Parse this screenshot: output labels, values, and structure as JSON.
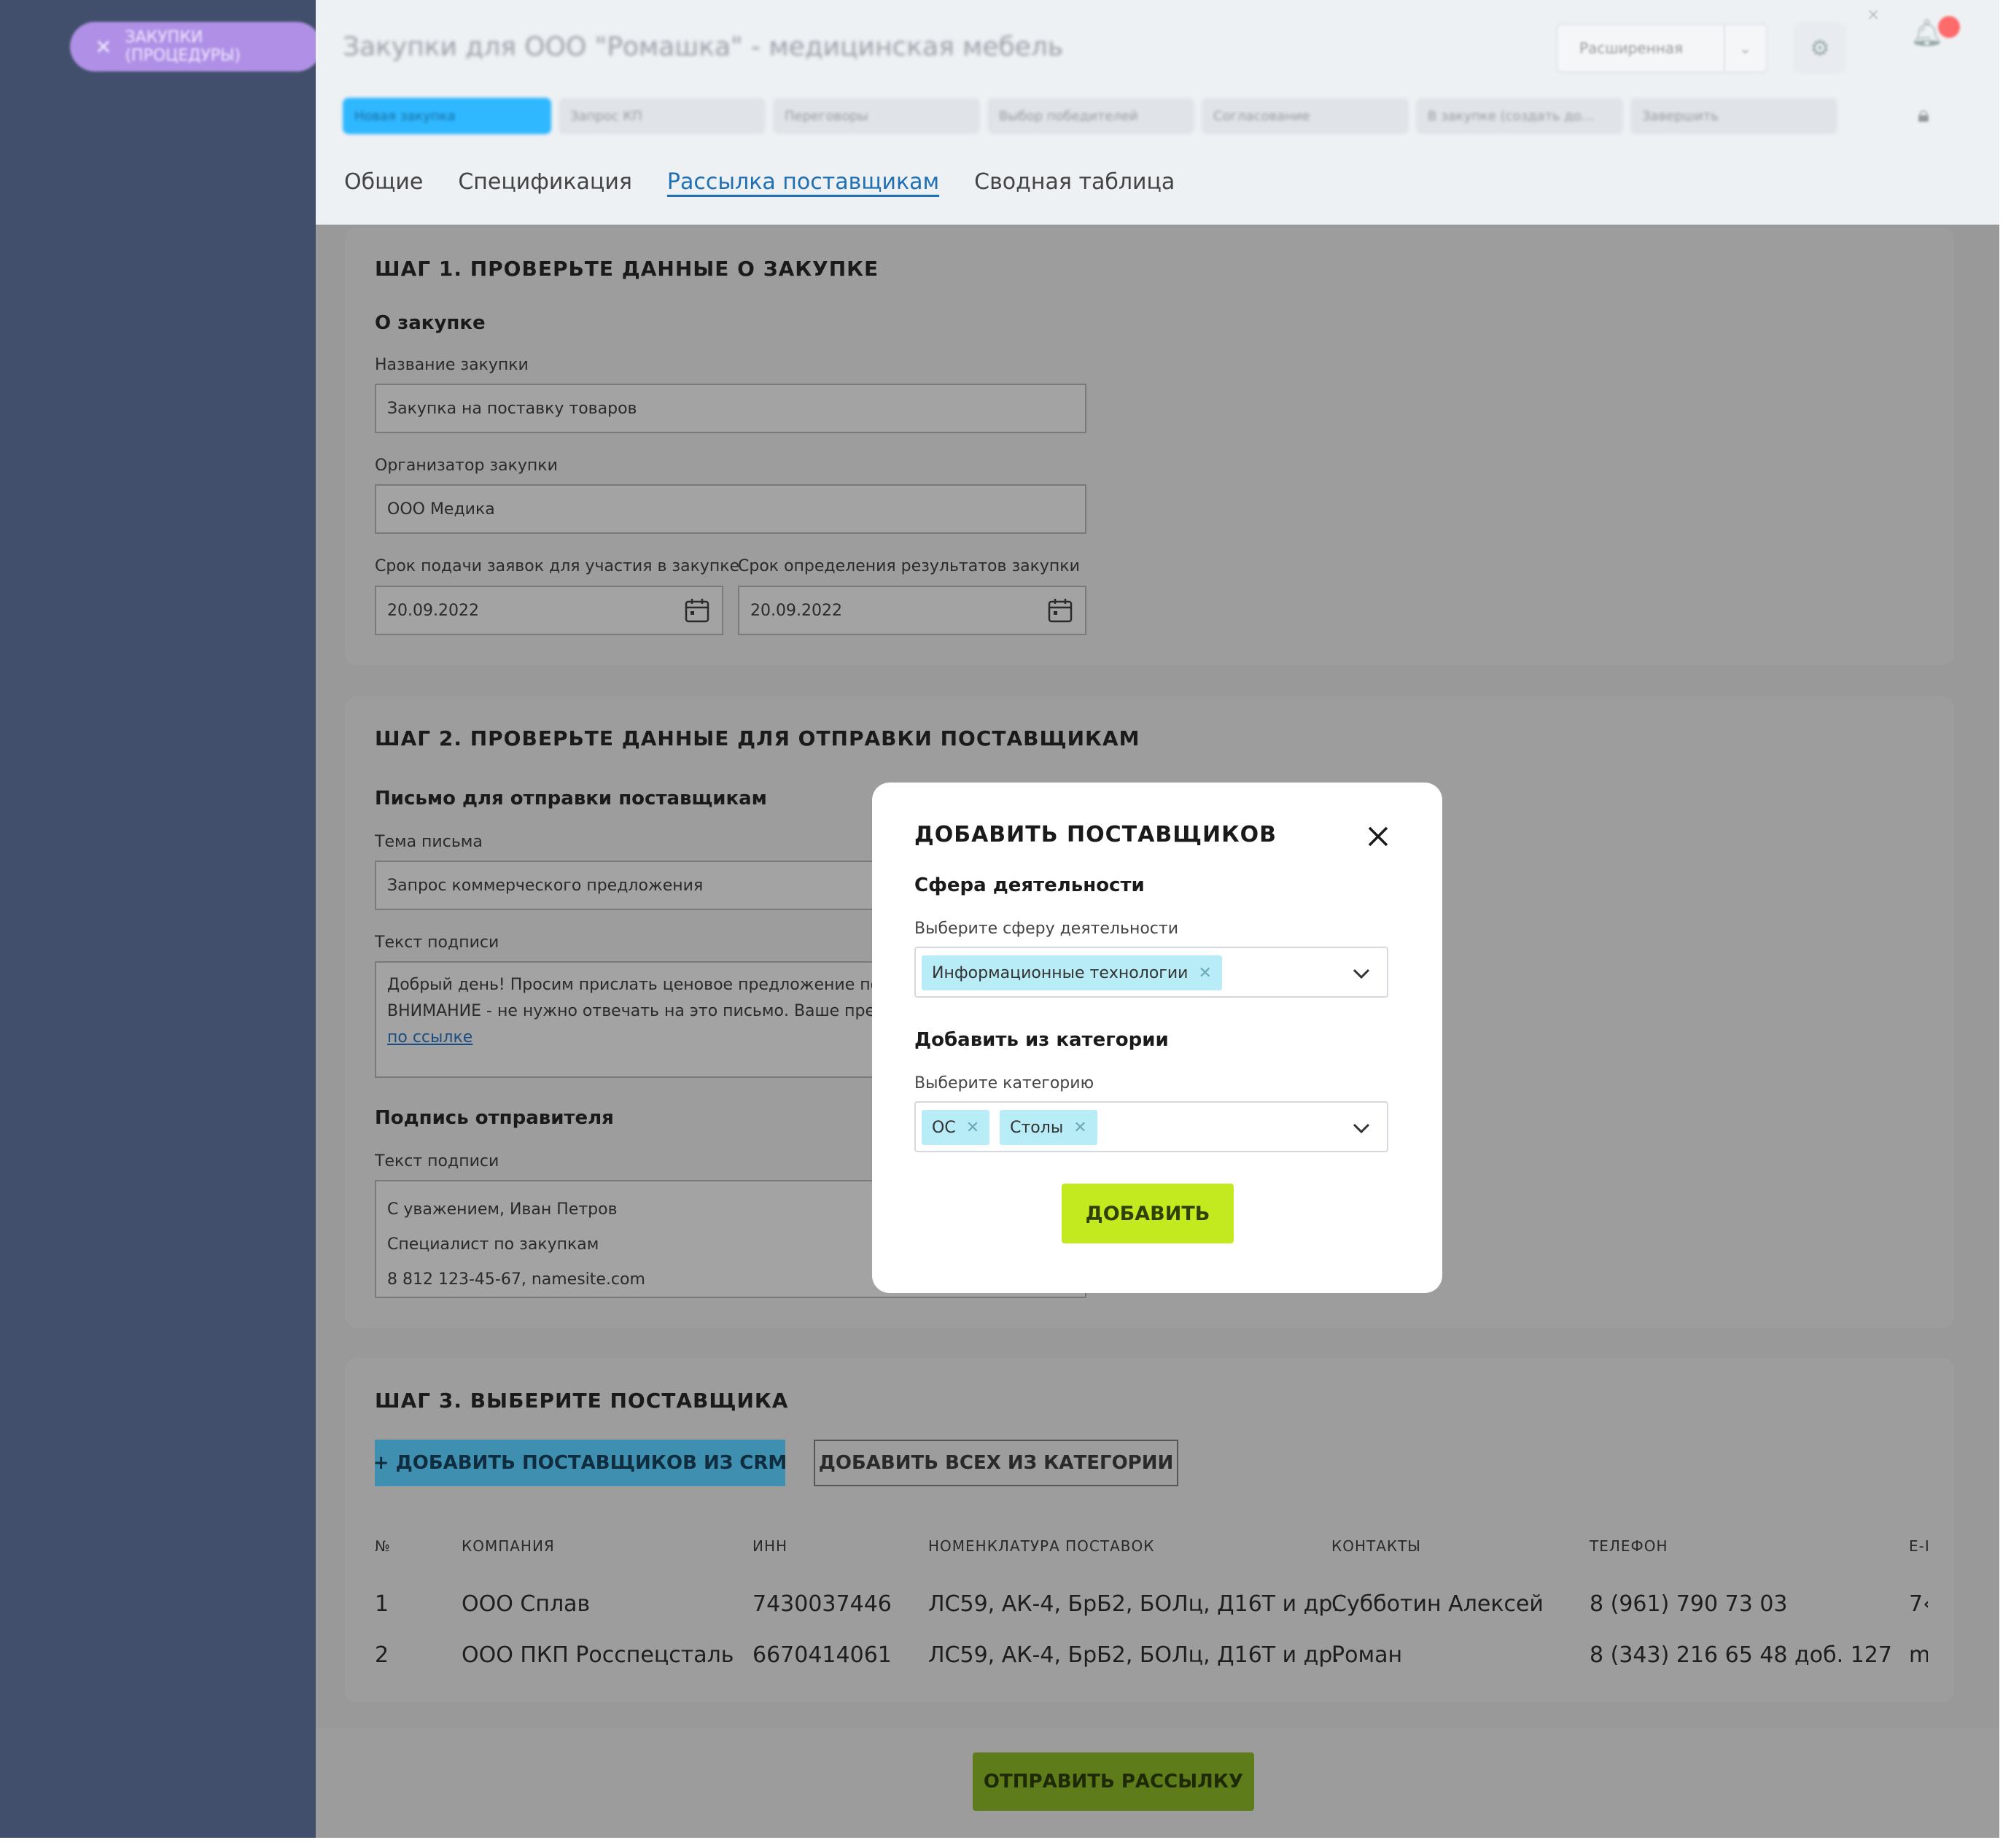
{
  "sidebar": {
    "back_label": "ЗАКУПКИ (ПРОЦЕДУРЫ)"
  },
  "header": {
    "title": "Закупки для ООО \"Ромашка\" - медицинская мебель",
    "view_select": "Расширенная",
    "stages": [
      {
        "label": "Новая закупка",
        "color": "#2fb8ff",
        "active": true
      },
      {
        "label": "Запрос КП",
        "color": "#e0e4e9",
        "active": false
      },
      {
        "label": "Переговоры",
        "color": "#e0e4e9",
        "active": false
      },
      {
        "label": "Выбор победителей",
        "color": "#e0e4e9",
        "active": false
      },
      {
        "label": "Согласование",
        "color": "#e0e4e9",
        "active": false
      },
      {
        "label": "В закупке (создать до...",
        "color": "#e0e4e9",
        "active": false
      },
      {
        "label": "Завершить",
        "color": "#e0e4e9",
        "active": false
      }
    ]
  },
  "tabs": [
    {
      "label": "Общие",
      "active": false
    },
    {
      "label": "Спецификация",
      "active": false
    },
    {
      "label": "Рассылка поставщикам",
      "active": true
    },
    {
      "label": "Сводная таблица",
      "active": false
    }
  ],
  "step1": {
    "title": "ШАГ 1. ПРОВЕРЬТЕ ДАННЫЕ О ЗАКУПКЕ",
    "section": "О закупке",
    "name_label": "Название закупки",
    "name_value": "Закупка на поставку товаров",
    "org_label": "Организатор закупки",
    "org_value": "ООО Медика",
    "deadline_label": "Срок подачи заявок для участия в закупке",
    "deadline_value": "20.09.2022",
    "result_label": "Срок определения результатов закупки",
    "result_value": "20.09.2022"
  },
  "step2": {
    "title": "ШАГ 2. ПРОВЕРЬТЕ ДАННЫЕ ДЛЯ ОТПРАВКИ ПОСТАВЩИКАМ",
    "letter_section": "Письмо для отправки поставщикам",
    "subject_label": "Тема письма",
    "subject_value": "Запрос коммерческого предложения",
    "body_label": "Текст подписи",
    "body_line1": "Добрый день! Просим прислать ценовое предложение по лотам",
    "body_line2": "ВНИМАНИЕ - не нужно отвечать на это письмо. Ваше предложение",
    "body_link": "по ссылке",
    "sign_section": "Подпись отправителя",
    "sign_label": "Текст подписи",
    "sign_line1": "С уважением, Иван Петров",
    "sign_line2": "Специалист по закупкам",
    "sign_line3": "8 812 123-45-67, namesite.com"
  },
  "step3": {
    "title": "ШАГ 3.  ВЫБЕРИТЕ ПОСТАВЩИКА",
    "crm_button": "+ ДОБАВИТЬ ПОСТАВЩИКОВ ИЗ CRM",
    "all_button": "ДОБАВИТЬ ВСЕХ ИЗ КАТЕГОРИИ",
    "columns": [
      "№",
      "КОМПАНИЯ",
      "ИНН",
      "НОМЕНКЛАТУРА ПОСТАВОК",
      "КОНТАКТЫ",
      "ТЕЛЕФОН",
      "E-I"
    ],
    "rows": [
      [
        "1",
        "ООО Сплав",
        "7430037446",
        "ЛС59, АК-4, БрБ2, БОЛц, Д16Т и др.",
        "Субботин Алексей",
        "8 (961) 790 73 03",
        "7‹"
      ],
      [
        "2",
        "ООО ПКП Росспецсталь",
        "6670414061",
        "ЛС59, АК-4, БрБ2, БОЛц, Д16Т и др.",
        "Роман",
        "8 (343) 216 65 48 доб. 127",
        "m"
      ]
    ]
  },
  "footer": {
    "send_button": "ОТПРАВИТЬ РАССЫЛКУ"
  },
  "modal": {
    "title": "ДОБАВИТЬ ПОСТАВЩИКОВ",
    "sphere_section": "Сфера деятельности",
    "sphere_label": "Выберите сферу деятельности",
    "sphere_chips": [
      "Информационные технологии"
    ],
    "category_section": "Добавить из категории",
    "category_label": "Выберите категорию",
    "category_chips": [
      "ОС",
      "Столы"
    ],
    "add_button": "ДОБАВИТЬ"
  },
  "colors": {
    "sidebar": "#424f6c",
    "accent_blue": "#2fb8ff",
    "add_green": "#c3ea1e",
    "chip": "#b8ecf6",
    "overlay": "#999999"
  }
}
